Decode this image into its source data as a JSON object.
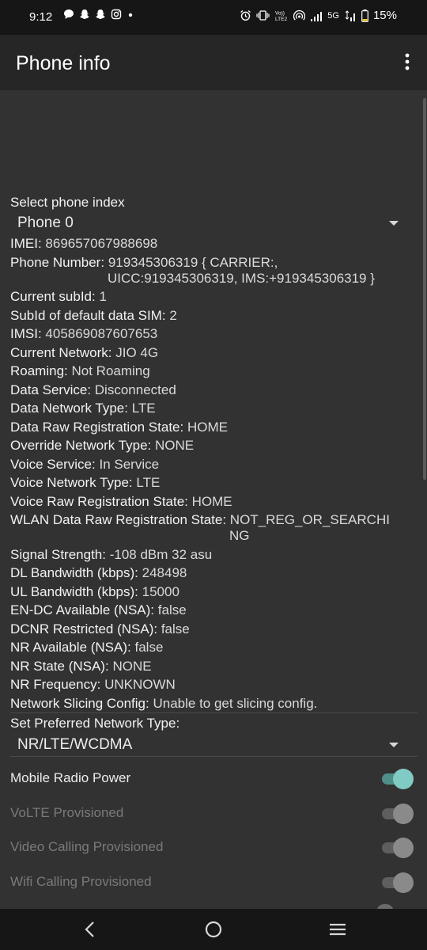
{
  "status_bar": {
    "time": "9:12",
    "network_label": "5G",
    "battery_percent": "15%",
    "icons": [
      "chat-icon",
      "snapchat-icon",
      "snapchat-icon",
      "instagram-icon",
      "dot-icon",
      "alarm-icon",
      "vibrate-icon",
      "volte-icon",
      "hotspot-icon",
      "signal-icon",
      "5g-signal-icon",
      "battery-icon"
    ]
  },
  "app_bar": {
    "title": "Phone info",
    "menu_icon": "more-vert-icon"
  },
  "phone_index": {
    "label": "Select phone index",
    "selected": "Phone 0"
  },
  "info": [
    {
      "label": "IMEI:",
      "value": "869657067988698"
    },
    {
      "label": "Phone Number:",
      "value": "919345306319 { CARRIER:,",
      "value2": "UICC:919345306319, IMS:+919345306319 }"
    },
    {
      "label": "Current subId:",
      "value": "1"
    },
    {
      "label": "SubId of default data SIM:",
      "value": "2"
    },
    {
      "label": "IMSI:",
      "value": "405869087607653"
    },
    {
      "label": "Current Network:",
      "value": "JIO 4G"
    },
    {
      "label": "Roaming:",
      "value": "Not Roaming"
    },
    {
      "label": "Data Service:",
      "value": "Disconnected"
    },
    {
      "label": "Data Network Type:",
      "value": "LTE"
    },
    {
      "label": "Data Raw Registration State:",
      "value": "HOME"
    },
    {
      "label": "Override Network Type:",
      "value": "NONE"
    },
    {
      "label": "Voice Service:",
      "value": "In Service"
    },
    {
      "label": "Voice Network Type:",
      "value": "LTE"
    },
    {
      "label": "Voice Raw Registration State:",
      "value": "HOME"
    },
    {
      "label": "WLAN Data Raw Registration State:",
      "value": "NOT_REG_OR_SEARCHI",
      "value2": "NG"
    },
    {
      "label": "Signal Strength:",
      "value": "-108 dBm   32 asu"
    },
    {
      "label": "DL Bandwidth (kbps):",
      "value": "248498"
    },
    {
      "label": "UL Bandwidth (kbps):",
      "value": "15000"
    },
    {
      "label": "EN-DC Available (NSA):",
      "value": "false"
    },
    {
      "label": "DCNR Restricted (NSA):",
      "value": "false"
    },
    {
      "label": "NR Available (NSA):",
      "value": "false"
    },
    {
      "label": "NR State (NSA):",
      "value": "NONE"
    },
    {
      "label": "NR Frequency:",
      "value": "UNKNOWN"
    },
    {
      "label": "Network Slicing Config:",
      "value": "Unable to get slicing config."
    }
  ],
  "preferred_network": {
    "label": "Set Preferred Network Type:",
    "selected": "NR/LTE/WCDMA"
  },
  "toggles": [
    {
      "label": "Mobile Radio Power",
      "on": true,
      "enabled": true
    },
    {
      "label": "VoLTE Provisioned",
      "on": true,
      "enabled": false
    },
    {
      "label": "Video Calling Provisioned",
      "on": true,
      "enabled": false
    },
    {
      "label": "Wifi Calling Provisioned",
      "on": true,
      "enabled": false
    }
  ],
  "colors": {
    "accent": "#80cbc4",
    "accent_track": "#4f8f8a",
    "disabled_text": "#7a7a7a",
    "disabled_thumb": "#8a8a8a",
    "disabled_track": "#5e5e5e"
  },
  "nav_bar": {
    "icons": [
      "back-icon",
      "home-icon",
      "recents-icon"
    ]
  }
}
